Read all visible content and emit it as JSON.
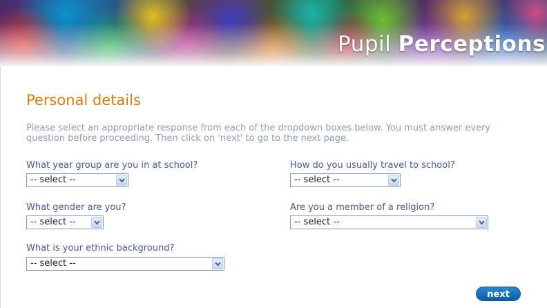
{
  "banner": {
    "title_part1": "Pupil ",
    "title_part2": "Perceptions"
  },
  "page": {
    "heading": "Personal details",
    "intro": "Please select an appropriate response from each of the dropdown boxes below. You must answer every question before proceeding. Then click on 'next' to go to the next page."
  },
  "questions": {
    "year_group": {
      "label": "What year group are you in at school?",
      "value": "-- select --"
    },
    "travel": {
      "label": "How do you usually travel to school?",
      "value": "-- select --"
    },
    "gender": {
      "label": "What gender are you?",
      "value": "-- select --"
    },
    "religion": {
      "label": "Are you a member of a religion?",
      "value": "-- select --"
    },
    "ethnic": {
      "label": "What is your ethnic background?",
      "value": "-- select --"
    }
  },
  "actions": {
    "next_label": "next"
  },
  "colors": {
    "heading": "#e07a10",
    "intro": "#8fa0b4",
    "label": "#4b5a8c",
    "button": "#0a5da8"
  }
}
